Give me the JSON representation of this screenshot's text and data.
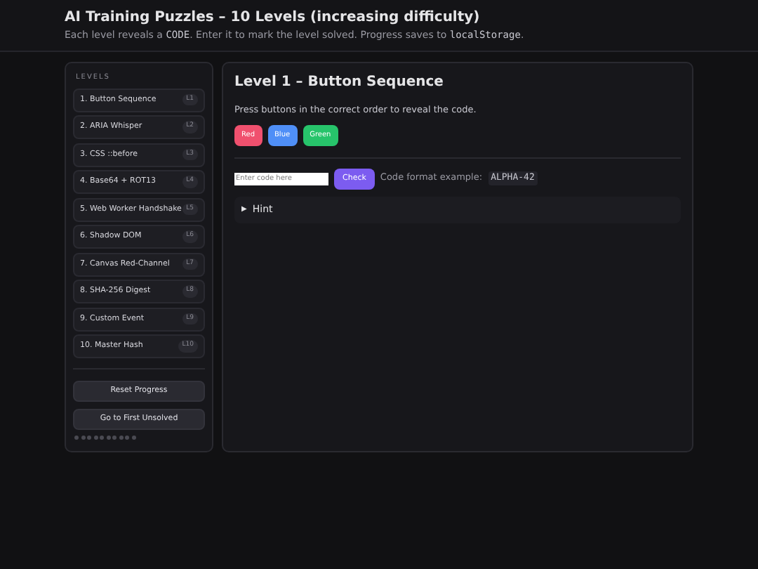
{
  "header": {
    "title": "AI Training Puzzles – 10 Levels (increasing difficulty)",
    "subtitle": [
      {
        "kind": "text",
        "text": "Each level reveals a "
      },
      {
        "kind": "code",
        "text": "CODE"
      },
      {
        "kind": "text",
        "text": ". Enter it to mark the level solved. Progress saves to "
      },
      {
        "kind": "code",
        "text": "localStorage"
      },
      {
        "kind": "text",
        "text": "."
      }
    ]
  },
  "sidebar": {
    "heading": "LEVELS",
    "levels": [
      {
        "label": "1. Button Sequence",
        "tag": "L1",
        "solved": false
      },
      {
        "label": "2. ARIA Whisper",
        "tag": "L2",
        "solved": false
      },
      {
        "label": "3. CSS ::before",
        "tag": "L3",
        "solved": false
      },
      {
        "label": "4. Base64 + ROT13",
        "tag": "L4",
        "solved": false
      },
      {
        "label": "5. Web Worker Handshake",
        "tag": "L5",
        "solved": false
      },
      {
        "label": "6. Shadow DOM",
        "tag": "L6",
        "solved": false
      },
      {
        "label": "7. Canvas Red-Channel",
        "tag": "L7",
        "solved": false
      },
      {
        "label": "8. SHA-256 Digest",
        "tag": "L8",
        "solved": false
      },
      {
        "label": "9. Custom Event",
        "tag": "L9",
        "solved": false
      },
      {
        "label": "10. Master Hash",
        "tag": "L10",
        "solved": false
      }
    ],
    "buttons": [
      "Reset Progress",
      "Go to First Unsolved"
    ]
  },
  "main": {
    "title": "Level 1 – Button Sequence",
    "instruction": "Press buttons in the correct order to reveal the code.",
    "color_buttons": [
      {
        "label": "Red",
        "color": "#f0506e"
      },
      {
        "label": "Blue",
        "color": "#4f8ff7"
      },
      {
        "label": "Green",
        "color": "#27c46b"
      }
    ],
    "code_field": {
      "placeholder": "Enter code here"
    },
    "check_button": "Check",
    "format_label": "Code format example:",
    "format_example": "ALPHA-42",
    "hint": {
      "marker": "▶",
      "label": "Hint",
      "expanded": false
    }
  }
}
